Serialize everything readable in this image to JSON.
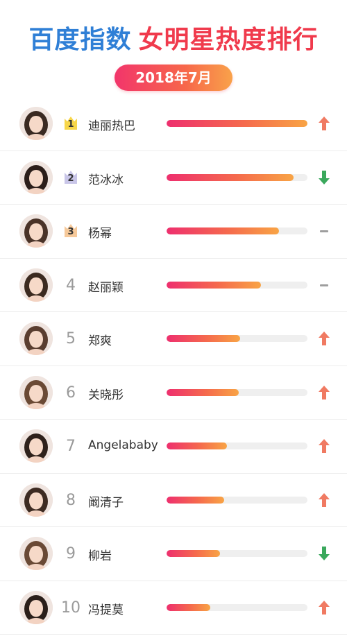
{
  "header": {
    "title_part1": "百度指数",
    "title_part2": "女明星热度排行",
    "date": "2018年7月"
  },
  "colors": {
    "title_blue": "#2f7fd6",
    "title_red": "#f03a4c",
    "trend_up": "#f07a62",
    "trend_down": "#3aa85c",
    "trend_flat": "#9e9e9e"
  },
  "rankings": [
    {
      "rank": "1",
      "name": "迪丽热巴",
      "heat_percent": 100,
      "trend": "up",
      "crown": "gold"
    },
    {
      "rank": "2",
      "name": "范冰冰",
      "heat_percent": 90,
      "trend": "down",
      "crown": "silver"
    },
    {
      "rank": "3",
      "name": "杨幂",
      "heat_percent": 80,
      "trend": "flat",
      "crown": "bronze"
    },
    {
      "rank": "4",
      "name": "赵丽颖",
      "heat_percent": 67,
      "trend": "flat"
    },
    {
      "rank": "5",
      "name": "郑爽",
      "heat_percent": 52,
      "trend": "up"
    },
    {
      "rank": "6",
      "name": "关晓彤",
      "heat_percent": 51,
      "trend": "up"
    },
    {
      "rank": "7",
      "name": "Angelababy",
      "heat_percent": 43,
      "trend": "up"
    },
    {
      "rank": "8",
      "name": "阚清子",
      "heat_percent": 41,
      "trend": "up"
    },
    {
      "rank": "9",
      "name": "柳岩",
      "heat_percent": 38,
      "trend": "down"
    },
    {
      "rank": "10",
      "name": "冯提莫",
      "heat_percent": 31,
      "trend": "up"
    }
  ]
}
